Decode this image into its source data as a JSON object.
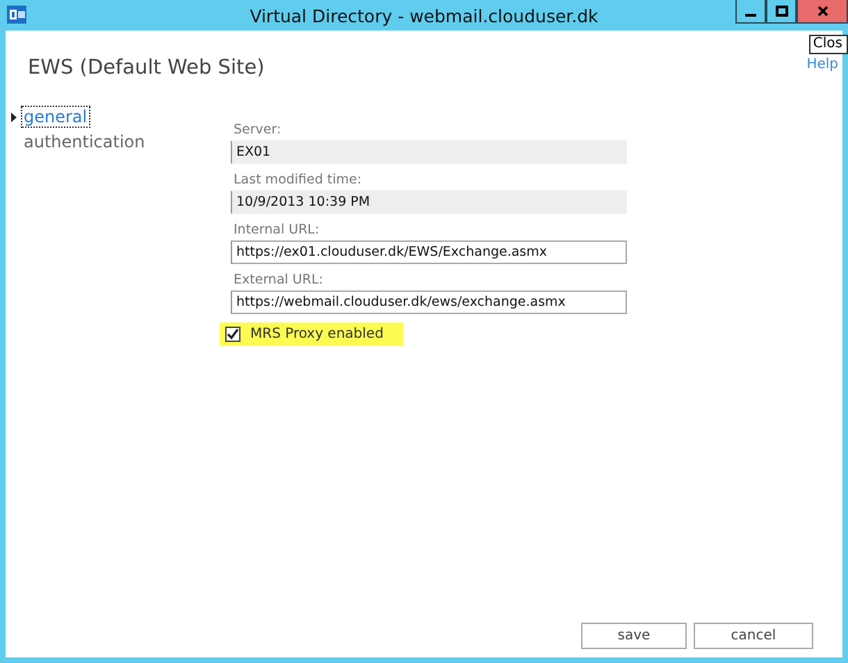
{
  "window": {
    "title": "Virtual Directory - webmail.clouduser.dk"
  },
  "tooltip": "Clos",
  "help": "Help",
  "heading": "EWS (Default Web Site)",
  "nav": [
    {
      "label": "general",
      "selected": true
    },
    {
      "label": "authentication",
      "selected": false
    }
  ],
  "fields": [
    {
      "label": "Server:",
      "value": "EX01",
      "disabled": true
    },
    {
      "label": "Last modified time:",
      "value": "10/9/2013 10:39 PM",
      "disabled": true
    },
    {
      "label": "Internal URL:",
      "value": "https://ex01.clouduser.dk/EWS/Exchange.asmx",
      "disabled": false
    },
    {
      "label": "External URL:",
      "value": "https://webmail.clouduser.dk/ews/exchange.asmx",
      "disabled": false
    }
  ],
  "checkbox": {
    "label": "MRS Proxy enabled",
    "checked": true,
    "highlighted": true
  },
  "buttons": [
    "save",
    "cancel"
  ]
}
